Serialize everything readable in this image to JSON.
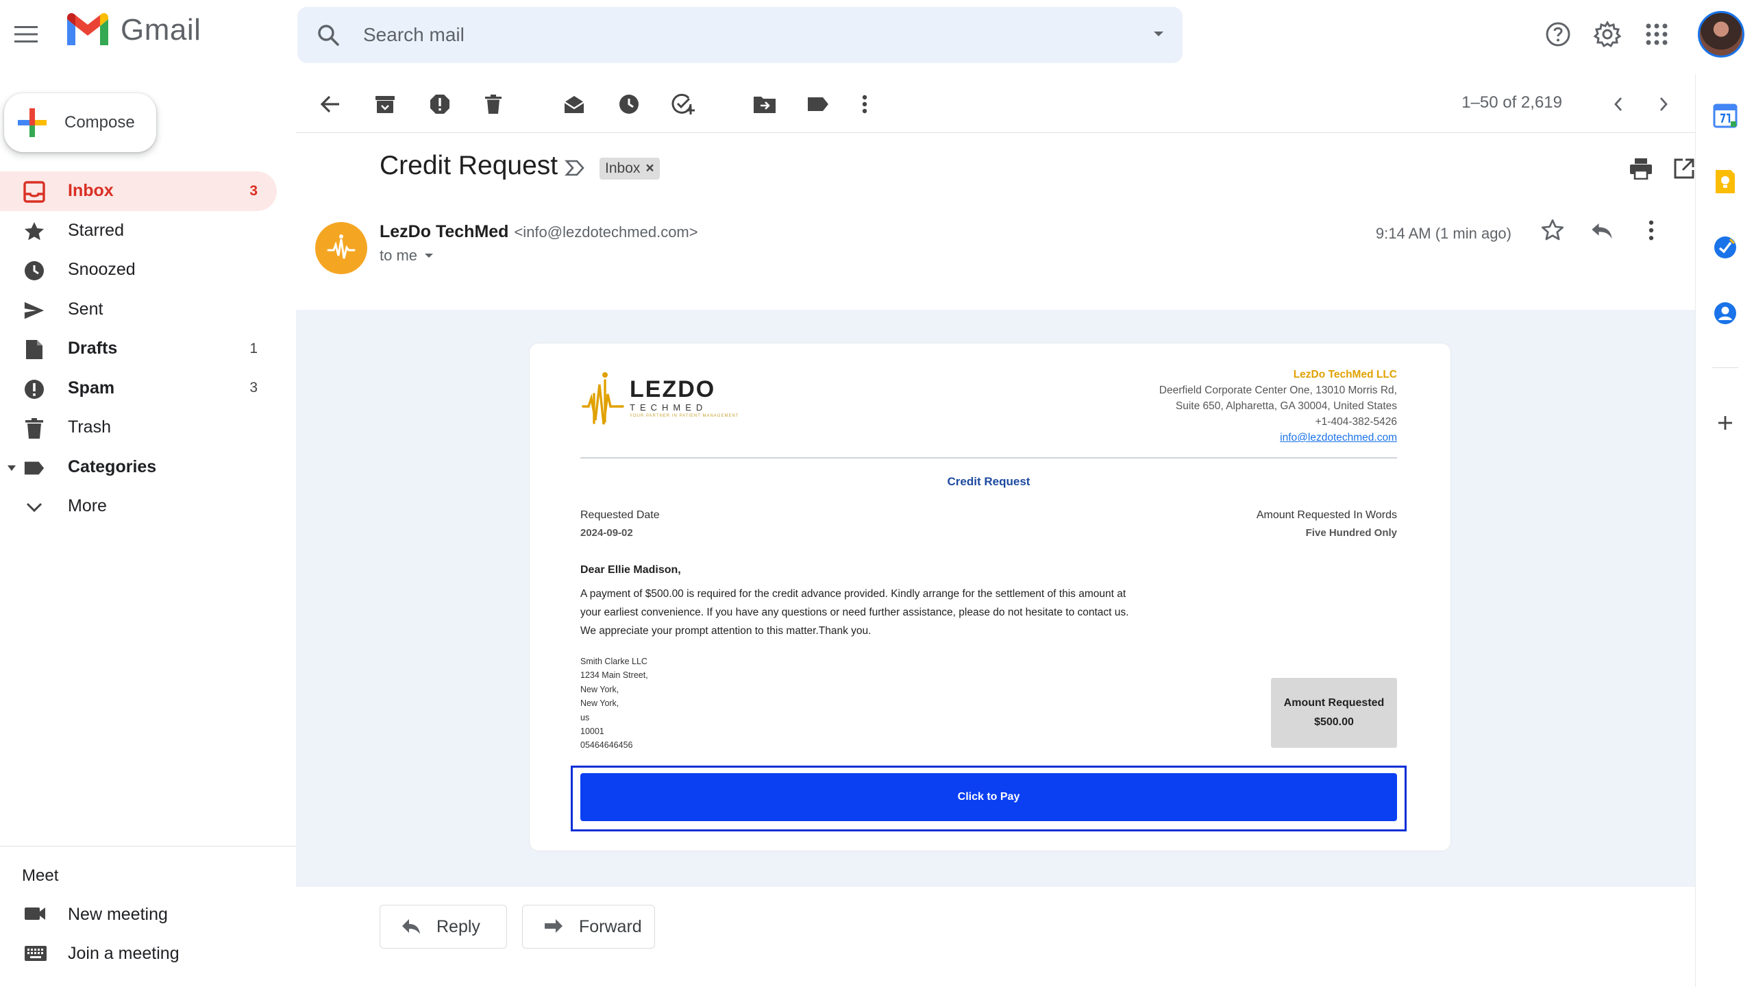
{
  "app": {
    "name": "Gmail"
  },
  "search": {
    "placeholder": "Search mail"
  },
  "compose": {
    "label": "Compose"
  },
  "nav": {
    "items": [
      {
        "label": "Inbox",
        "count": "3"
      },
      {
        "label": "Starred",
        "count": ""
      },
      {
        "label": "Snoozed",
        "count": ""
      },
      {
        "label": "Sent",
        "count": ""
      },
      {
        "label": "Drafts",
        "count": "1"
      },
      {
        "label": "Spam",
        "count": "3"
      },
      {
        "label": "Trash",
        "count": ""
      },
      {
        "label": "Categories",
        "count": ""
      },
      {
        "label": "More",
        "count": ""
      }
    ]
  },
  "meet": {
    "title": "Meet",
    "new_meeting": "New meeting",
    "join_meeting": "Join a meeting"
  },
  "toolbar": {
    "pager": "1–50 of 2,619"
  },
  "email": {
    "subject": "Credit Request",
    "label_chip": "Inbox",
    "chip_close": "×",
    "sender_name": "LezDo TechMed",
    "sender_email": "<info@lezdotechmed.com>",
    "to": "to me",
    "time": "9:14 AM (1 min ago)"
  },
  "letter": {
    "brand_main": "LEZDO",
    "brand_sub": "TECHMED",
    "brand_tag": "YOUR PARTNER IN PATIENT MANAGEMENT",
    "company_name": "LezDo TechMed LLC",
    "company_address_1": "Deerfield Corporate Center One, 13010 Morris Rd,",
    "company_address_2": "Suite 650, Alpharetta, GA 30004, United States",
    "company_phone": "+1-404-382-5426",
    "company_email": "info@lezdotechmed.com",
    "title": "Credit Request",
    "requested_date_label": "Requested Date",
    "requested_date": "2024-09-02",
    "amount_words_label": "Amount Requested In Words",
    "amount_words": "Five Hundred Only",
    "greeting": "Dear Ellie Madison,",
    "para_1": "A payment of $500.00 is required for the credit advance provided. Kindly arrange for the settlement of this amount at",
    "para_2": "your earliest convenience. If you have any questions or need further assistance, please do not hesitate to contact us.",
    "para_3": "We appreciate your prompt attention to this matter.Thank you.",
    "address": [
      "Smith Clarke LLC",
      "1234 Main Street,",
      "New York,",
      "New York,",
      "us",
      "10001",
      "05464646456"
    ],
    "amount_label": "Amount Requested",
    "amount_value": "$500.00",
    "pay_button": "Click to Pay"
  },
  "actions": {
    "reply": "Reply",
    "forward": "Forward"
  },
  "colors": {
    "accent_red": "#d93025",
    "pay_blue": "#0b3ff2",
    "brand_gold": "#e0a100",
    "email_bg": "#eef2f9"
  }
}
